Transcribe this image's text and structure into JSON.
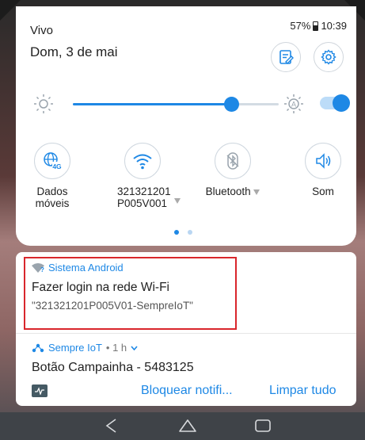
{
  "status_bar": {
    "carrier": "Vivo",
    "battery": "57%",
    "time": "10:39"
  },
  "quick_settings": {
    "date": "Dom, 3 de mai",
    "brightness": 0.77,
    "auto_brightness_on": true,
    "tiles": [
      {
        "label": "Dados\nmóveis",
        "icon": "globe-4g-icon"
      },
      {
        "label": "321321201\nP005V001",
        "icon": "wifi-icon"
      },
      {
        "label": "Bluetooth",
        "icon": "bluetooth-off-icon"
      },
      {
        "label": "Som",
        "icon": "speaker-icon"
      }
    ],
    "page_count": 2,
    "active_page": 1
  },
  "notifications": [
    {
      "app": "Sistema Android",
      "title": "Fazer login na rede Wi-Fi",
      "subtitle": "\"321321201P005V01-SempreIoT\""
    },
    {
      "app": "Sempre IoT",
      "meta": "• 1 h",
      "title": "Botão Campainha  - 5483125",
      "actions": {
        "block": "Bloquear notifi...",
        "clear": "Limpar tudo"
      }
    }
  ],
  "colors": {
    "accent": "#1e88e5",
    "highlight": "#d9262c"
  }
}
